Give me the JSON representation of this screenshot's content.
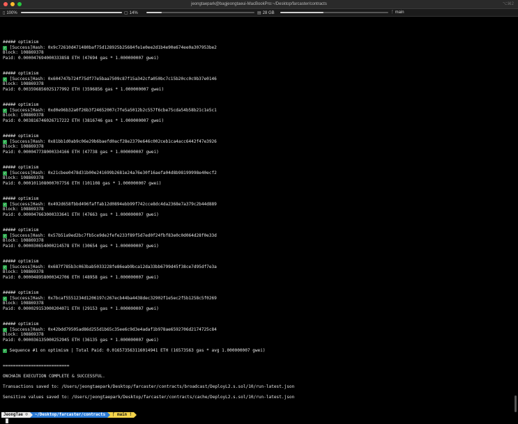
{
  "window": {
    "title": "jeongtaepark@bagjeongtaeui-MacBookPro:~/Desktop/farcaster/contracts",
    "shortcut": "⌥⌘2"
  },
  "status": {
    "battery": "100%",
    "cpu": "14%",
    "memory": "28 GB",
    "branch": "main"
  },
  "terminal": {
    "lines": [
      {
        "text": ""
      },
      {
        "text": ""
      },
      {
        "text": ""
      },
      {
        "text": ""
      },
      {
        "text": "##### optimism"
      },
      {
        "text": "[Success]Hash: 0x9c72610d471480baf75d128925b25684fe1e0ee2d1b4e90e674ee0a307953be2",
        "check": true
      },
      {
        "text": "Block: 108869378"
      },
      {
        "text": "Paid: 0.000047694000333858 ETH (47694 gas * 1.000000007 gwei)"
      },
      {
        "text": ""
      },
      {
        "text": ""
      },
      {
        "text": "##### optimism"
      },
      {
        "text": "[Success]Hash: 0x604747b724f75df77e5baa7509c87f15a342cfa050bc7c15b20cc0c9b37e0146",
        "check": true
      },
      {
        "text": "Block: 108869378"
      },
      {
        "text": "Paid: 0.003596856025177992 ETH (3596856 gas * 1.000000007 gwei)"
      },
      {
        "text": ""
      },
      {
        "text": ""
      },
      {
        "text": "##### optimism"
      },
      {
        "text": "[Success]Hash: 0xd0e96b32a0f26b3f24652007c7fe5a5012b2c557f6cbe75cda54b58b21c1e5c1",
        "check": true
      },
      {
        "text": "Block: 108869378"
      },
      {
        "text": "Paid: 0.003816746026717222 ETH (3816746 gas * 1.000000007 gwei)"
      },
      {
        "text": ""
      },
      {
        "text": ""
      },
      {
        "text": "##### optimism"
      },
      {
        "text": "[Success]Hash: 0x81bb1d0ab9c06e29b6baefd0acf28e2379e646c002ceb1ca4acc6442f47e3926",
        "check": true
      },
      {
        "text": "Block: 108869378"
      },
      {
        "text": "Paid: 0.000047738000334166 ETH (47738 gas * 1.000000007 gwei)"
      },
      {
        "text": ""
      },
      {
        "text": ""
      },
      {
        "text": "##### optimism"
      },
      {
        "text": "[Success]Hash: 0x21cbee0478d31b00e241699b2681e24a76e30f16aefa04d8b98199998e40ecf2",
        "check": true
      },
      {
        "text": "Block: 108869378"
      },
      {
        "text": "Paid: 0.000101108000707756 ETH (101108 gas * 1.000000007 gwei)"
      },
      {
        "text": ""
      },
      {
        "text": ""
      },
      {
        "text": "##### optimism"
      },
      {
        "text": "[Success]Hash: 0x492d658fbbd496faffab12d0894ebb99f742cce8dc4da2368e7a379c2b44d889",
        "check": true
      },
      {
        "text": "Block: 108869378"
      },
      {
        "text": "Paid: 0.000047663000333641 ETH (47663 gas * 1.000000007 gwei)"
      },
      {
        "text": ""
      },
      {
        "text": ""
      },
      {
        "text": "##### optimism"
      },
      {
        "text": "[Success]Hash: 0x57b51a9ed2bc7fb5ce9de2fefe233f89f5d7ed0f24fbf83e0c0d064d28f0e33d",
        "check": true
      },
      {
        "text": "Block: 108869378"
      },
      {
        "text": "Paid: 0.000030654000214578 ETH (30654 gas * 1.000000007 gwei)"
      },
      {
        "text": ""
      },
      {
        "text": ""
      },
      {
        "text": "##### optimism"
      },
      {
        "text": "[Success]Hash: 0x687f785b3c063bab5033228fe86eab9bca12da33bb6799d45f38ce7d95df7e3a",
        "check": true
      },
      {
        "text": "Block: 108869378"
      },
      {
        "text": "Paid: 0.000048958000342706 ETH (48958 gas * 1.000000007 gwei)"
      },
      {
        "text": ""
      },
      {
        "text": ""
      },
      {
        "text": "##### optimism"
      },
      {
        "text": "[Success]Hash: 0x7bcaf5551234d1206197c267ecb44ba4438dec32902f1e5ec2f5b1258c5f0269",
        "check": true
      },
      {
        "text": "Block: 108869378"
      },
      {
        "text": "Paid: 0.000029153000204071 ETH (29153 gas * 1.000000007 gwei)"
      },
      {
        "text": ""
      },
      {
        "text": ""
      },
      {
        "text": "##### optimism"
      },
      {
        "text": "[Success]Hash: 0x42bdd79505ad86d255d1b65c35ee6c9d3e4adaf1b978ae6592706d2174725c84",
        "check": true
      },
      {
        "text": "Block: 108869378"
      },
      {
        "text": "Paid: 0.000036135000252945 ETH (36135 gas * 1.000000007 gwei)"
      },
      {
        "text": ""
      },
      {
        "text": "Sequence #1 on optimism | Total Paid: 0.016573563116014941 ETH (16573563 gas * avg 1.000000007 gwei)",
        "check": true
      },
      {
        "text": ""
      },
      {
        "text": ""
      },
      {
        "text": "=========================="
      },
      {
        "text": ""
      },
      {
        "text": "ONCHAIN EXECUTION COMPLETE & SUCCESSFUL."
      },
      {
        "text": ""
      },
      {
        "text": "Transactions saved to: /Users/jeongtaepark/Desktop/farcaster/contracts/broadcast/DeployL2.s.sol/10/run-latest.json"
      },
      {
        "text": ""
      },
      {
        "text": "Sensitive values saved to: /Users/jeongtaepark/Desktop/farcaster/contracts/cache/DeployL2.s.sol/10/run-latest.json"
      },
      {
        "text": ""
      }
    ]
  },
  "prompt": {
    "user": "JeongTae",
    "path": "~/Desktop/farcaster/contracts",
    "branch": "main !"
  }
}
